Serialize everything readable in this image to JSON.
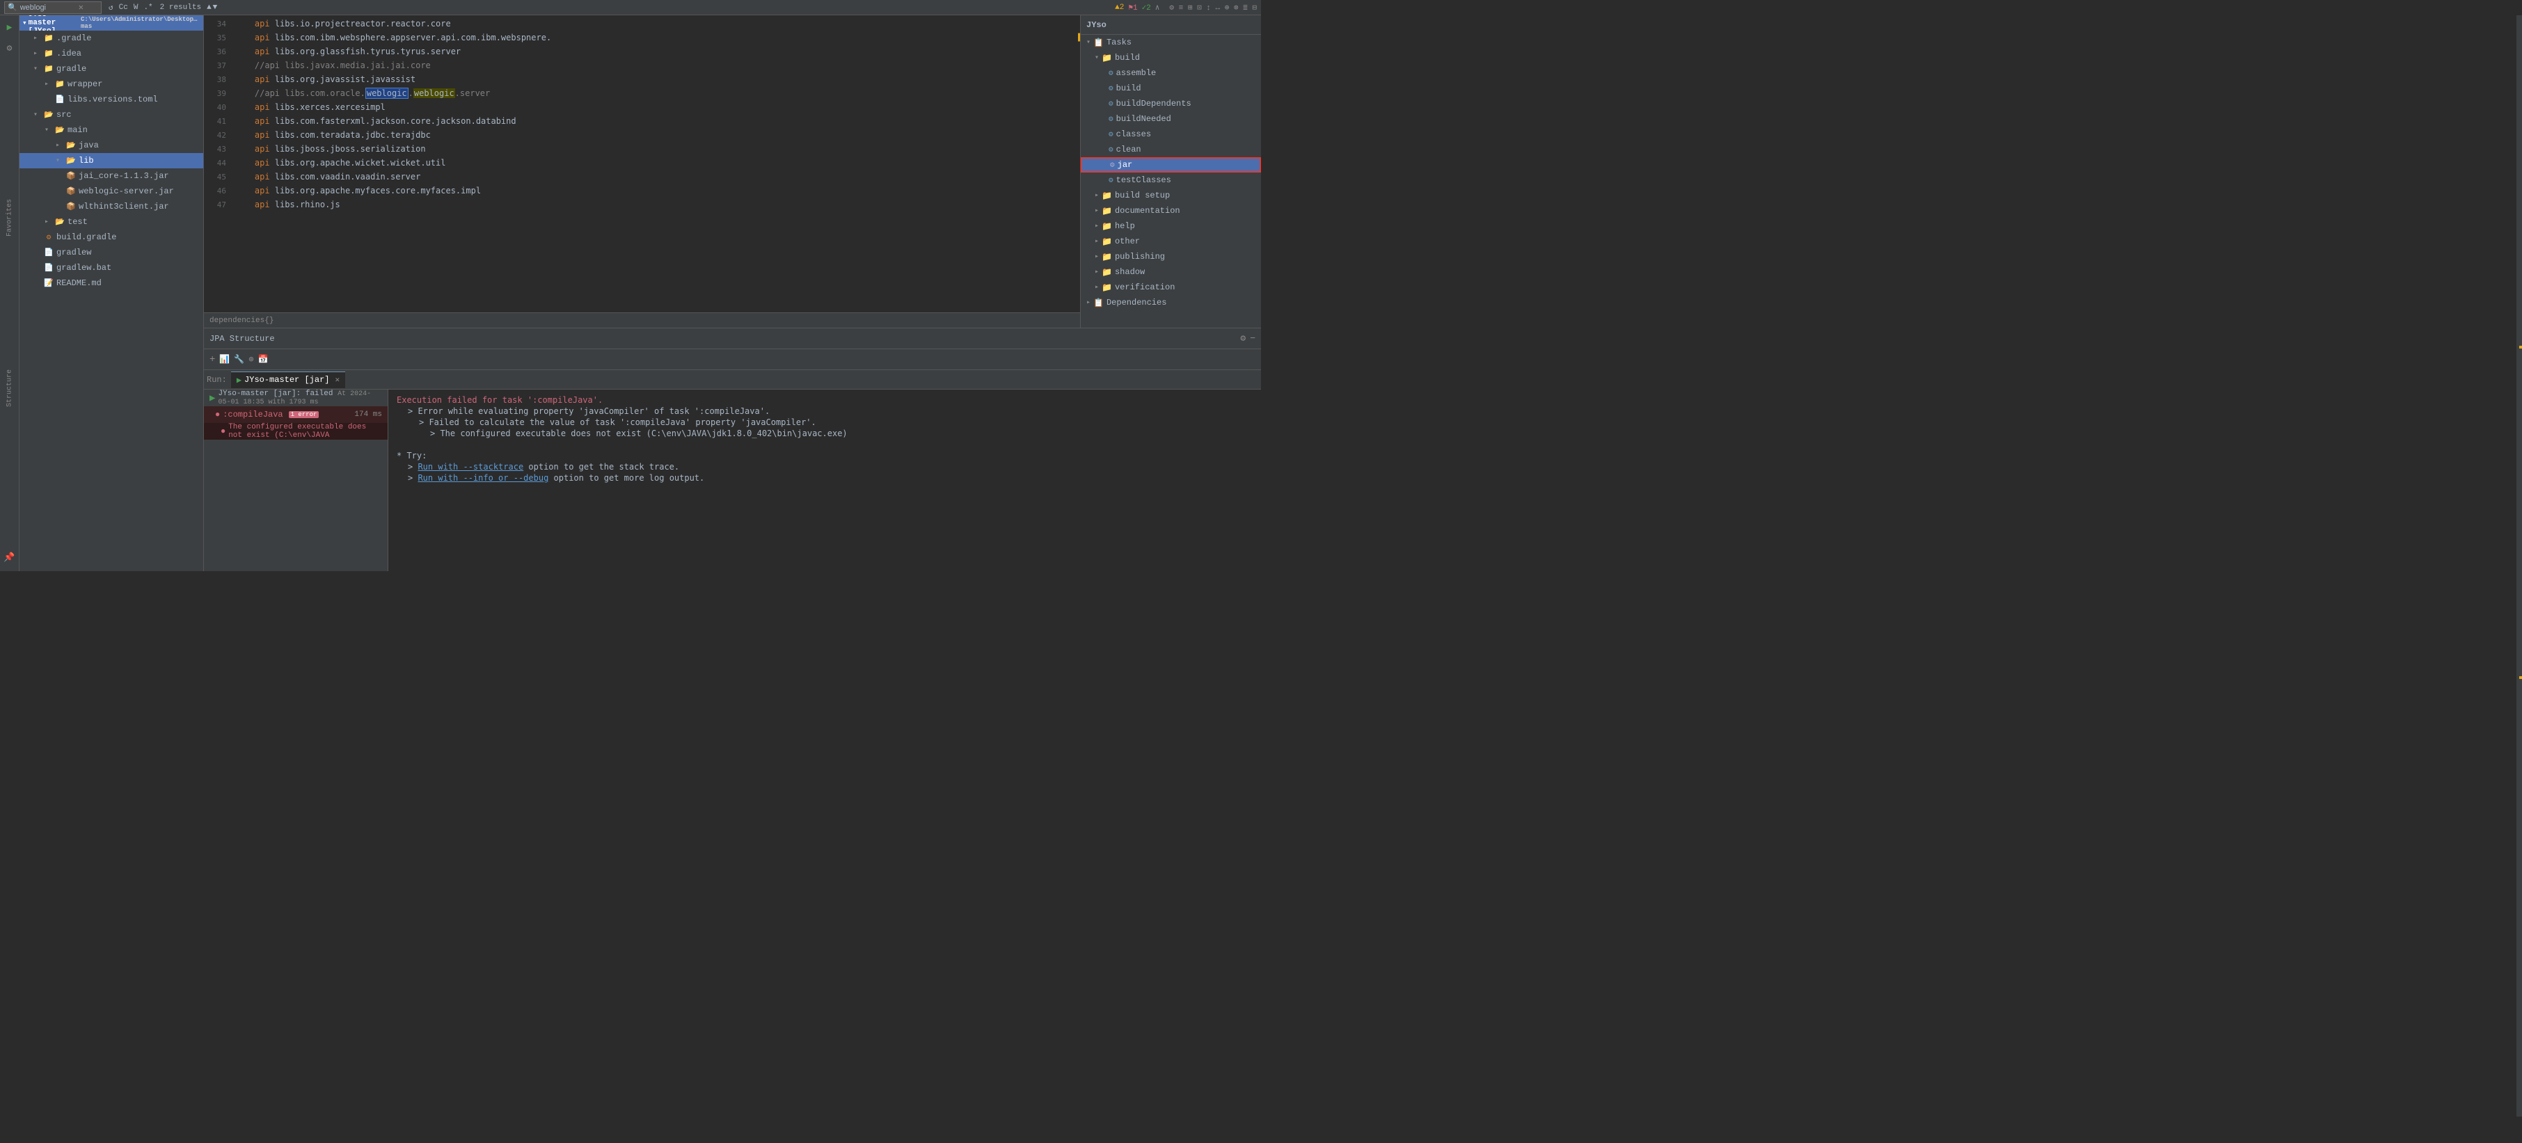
{
  "topbar": {
    "search_placeholder": "weblogi",
    "results": "2 results",
    "icons": [
      "✕",
      "↺",
      "Cc",
      "W",
      ".*"
    ]
  },
  "warnings": {
    "warn_count": "▲2",
    "error_count": "⚑1",
    "ok_count": "✓2",
    "caret": "∧"
  },
  "project_tree": {
    "title": "JYso-master [JYso]",
    "path": "C:\\Users\\Administrator\\Desktop\\gradleproject\\JYso-mas",
    "items": [
      {
        "label": ".gradle",
        "type": "folder",
        "indent": 1,
        "open": false
      },
      {
        "label": ".idea",
        "type": "folder",
        "indent": 1,
        "open": false
      },
      {
        "label": "gradle",
        "type": "folder",
        "indent": 1,
        "open": true
      },
      {
        "label": "wrapper",
        "type": "folder",
        "indent": 2,
        "open": false
      },
      {
        "label": "libs.versions.toml",
        "type": "file-toml",
        "indent": 3
      },
      {
        "label": "src",
        "type": "folder-src",
        "indent": 1,
        "open": true
      },
      {
        "label": "main",
        "type": "folder-blue",
        "indent": 2,
        "open": true
      },
      {
        "label": "java",
        "type": "folder-src",
        "indent": 3,
        "open": false
      },
      {
        "label": "lib",
        "type": "folder-blue",
        "indent": 3,
        "open": true,
        "selected": true
      },
      {
        "label": "jai_core-1.1.3.jar",
        "type": "jar",
        "indent": 4,
        "open": false
      },
      {
        "label": "weblogic-server.jar",
        "type": "jar",
        "indent": 4,
        "open": false
      },
      {
        "label": "wlthint3client.jar",
        "type": "jar",
        "indent": 4,
        "open": false
      },
      {
        "label": "test",
        "type": "folder-src",
        "indent": 2,
        "open": false
      },
      {
        "label": "build.gradle",
        "type": "file-gradle",
        "indent": 1
      },
      {
        "label": "gradlew",
        "type": "file",
        "indent": 1
      },
      {
        "label": "gradlew.bat",
        "type": "file-bat",
        "indent": 1
      },
      {
        "label": "README.md",
        "type": "file-md",
        "indent": 1
      }
    ]
  },
  "editor": {
    "lines": [
      {
        "num": "34",
        "content": "    api libs.io.projectreactor.reactor.core"
      },
      {
        "num": "35",
        "content": "    api libs.com.ibm.websphere.appserver.api.com.ibm.webspnere."
      },
      {
        "num": "36",
        "content": "    api libs.org.glassfish.tyrus.tyrus.server"
      },
      {
        "num": "37",
        "content": "    //api libs.javax.media.jai.jai.core"
      },
      {
        "num": "38",
        "content": "    api libs.org.javassist.javassist"
      },
      {
        "num": "39",
        "content": "    //api libs.com.oracle.weblogic.weblogic.server",
        "highlight1": "weblogic",
        "highlight2": "weblogic"
      },
      {
        "num": "40",
        "content": "    api libs.xerces.xercesimpl"
      },
      {
        "num": "41",
        "content": "    api libs.com.fasterxml.jackson.core.jackson.databind"
      },
      {
        "num": "42",
        "content": "    api libs.com.teradata.jdbc.terajdbc"
      },
      {
        "num": "43",
        "content": "    api libs.jboss.jboss.serialization"
      },
      {
        "num": "44",
        "content": "    api libs.org.apache.wicket.wicket.util"
      },
      {
        "num": "45",
        "content": "    api libs.com.vaadin.vaadin.server"
      },
      {
        "num": "46",
        "content": "    api libs.org.apache.myfaces.core.myfaces.impl"
      },
      {
        "num": "47",
        "content": "    api libs.rhino.js"
      }
    ],
    "footer": "dependencies{}"
  },
  "gradle_panel": {
    "title": "JYso",
    "sections": [
      {
        "label": "Tasks",
        "indent": 1,
        "open": true,
        "type": "group"
      },
      {
        "label": "build",
        "indent": 2,
        "open": true,
        "type": "group"
      },
      {
        "label": "assemble",
        "indent": 3,
        "type": "task"
      },
      {
        "label": "build",
        "indent": 3,
        "type": "task"
      },
      {
        "label": "buildDependents",
        "indent": 3,
        "type": "task"
      },
      {
        "label": "buildNeeded",
        "indent": 3,
        "type": "task"
      },
      {
        "label": "classes",
        "indent": 3,
        "type": "task"
      },
      {
        "label": "clean",
        "indent": 3,
        "type": "task"
      },
      {
        "label": "jar",
        "indent": 3,
        "type": "task",
        "selected": true
      },
      {
        "label": "testClasses",
        "indent": 3,
        "type": "task"
      },
      {
        "label": "build setup",
        "indent": 2,
        "open": false,
        "type": "group"
      },
      {
        "label": "documentation",
        "indent": 2,
        "open": false,
        "type": "group"
      },
      {
        "label": "help",
        "indent": 2,
        "open": false,
        "type": "group"
      },
      {
        "label": "other",
        "indent": 2,
        "open": false,
        "type": "group"
      },
      {
        "label": "publishing",
        "indent": 2,
        "open": false,
        "type": "group"
      },
      {
        "label": "shadow",
        "indent": 2,
        "open": false,
        "type": "group"
      },
      {
        "label": "verification",
        "indent": 2,
        "open": false,
        "type": "group"
      },
      {
        "label": "Dependencies",
        "indent": 1,
        "open": false,
        "type": "group"
      }
    ]
  },
  "jpa": {
    "title": "JPA Structure"
  },
  "run": {
    "tab_label": "Run:",
    "tab_name": "JYso-master [jar]",
    "build_item": {
      "label": "JYso-master [jar]: failed",
      "time_label": "At 2024-05-01 18:35 with 1793 ms"
    },
    "error_item": {
      "label": ":compileJava",
      "badge": "1 error",
      "time": "174 ms"
    },
    "sub_error": "The configured executable does not exist (C:\\env\\JAVA"
  },
  "output": {
    "lines": [
      {
        "text": "Execution failed for task ':compileJava'.",
        "style": "error"
      },
      {
        "text": "> Error while evaluating property 'javaCompiler' of task ':compileJava'.",
        "style": "normal",
        "indent": 1
      },
      {
        "text": "> Failed to calculate the value of task ':compileJava' property 'javaCompiler'.",
        "style": "normal",
        "indent": 2
      },
      {
        "text": "> The configured executable does not exist (C:\\env\\JAVA\\jdk1.8.0_402\\bin\\javac.exe)",
        "style": "normal",
        "indent": 3
      },
      {
        "text": "",
        "style": "normal"
      },
      {
        "text": "* Try:",
        "style": "normal"
      },
      {
        "text": "> Run with --stacktrace option to get the stack trace.",
        "style": "normal",
        "link": "Run with --stacktrace",
        "indent": 1
      },
      {
        "text": "> Run with --info or --debug option to get more log output.",
        "style": "normal",
        "link": "Run with --info or --debug",
        "indent": 1
      }
    ]
  }
}
